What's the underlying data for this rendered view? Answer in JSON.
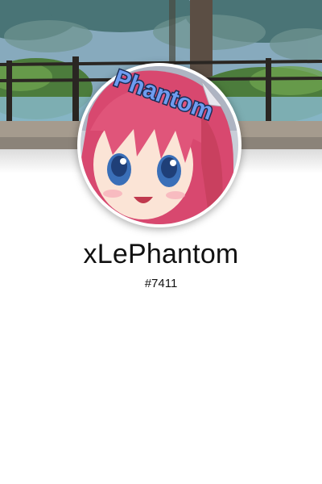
{
  "profile": {
    "username": "xLePhantom",
    "discriminator": "#7411",
    "avatar_badge_text": "Phantom"
  },
  "colors": {
    "background": "#ffffff",
    "text": "#111111",
    "avatar_hair": "#e0557a",
    "avatar_eyes": "#3a6fb8"
  }
}
